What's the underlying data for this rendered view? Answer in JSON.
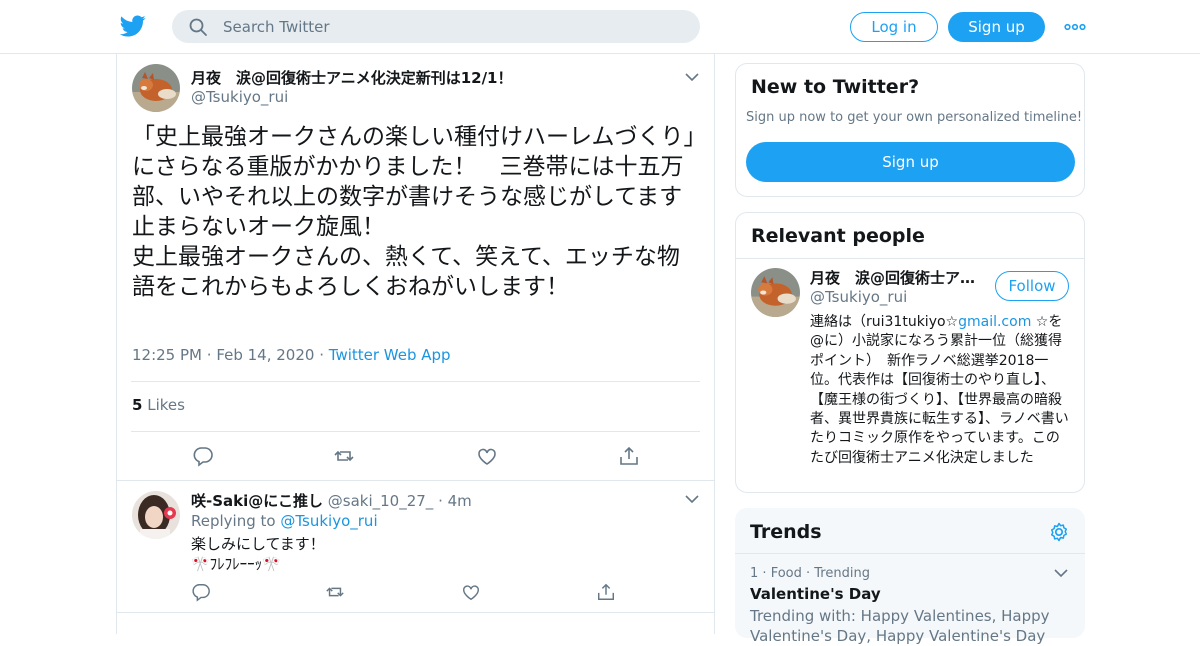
{
  "header": {
    "search_placeholder": "Search Twitter",
    "login_label": "Log in",
    "signup_label": "Sign up",
    "brand_color": "#1da1f2",
    "icons": [
      "twitter-bird-icon",
      "search-icon",
      "more-dots-icon"
    ]
  },
  "tweet": {
    "author_name": "月夜　涙@回復術士アニメ化決定新刊は12/1！",
    "author_handle": "@Tsukiyo_rui",
    "text": "「史上最強オークさんの楽しい種付けハーレムづくり」にさらなる重版がかかりました！　三巻帯には十五万部、いやそれ以上の数字が書けそうな感じがしてます\n止まらないオーク旋風！\n史上最強オークさんの、熱くて、笑えて、エッチな物語をこれからもよろしくおねがいします！",
    "time": "12:25 PM",
    "date": "Feb 14, 2020",
    "source": "Twitter Web App",
    "likes_count": "5",
    "likes_label": "Likes",
    "actions": [
      "reply-icon",
      "retweet-icon",
      "like-icon",
      "share-icon"
    ]
  },
  "reply": {
    "author_name": "咲-Saki@にこ推し",
    "author_handle": "@saki_10_27_",
    "age": "4m",
    "replying_label": "Replying to",
    "replying_to": "@Tsukiyo_rui",
    "text": "楽しみにしてます！\n🎌ﾌﾚﾌﾚｰｰｯ🎌"
  },
  "sidebar": {
    "new_card": {
      "title": "New to Twitter?",
      "subtitle": "Sign up now to get your own personalized timeline!",
      "button": "Sign up"
    },
    "relevant": {
      "title": "Relevant people",
      "name": "月夜　涙@回復術士ア…",
      "handle": "@Tsukiyo_rui",
      "follow_label": "Follow",
      "bio_pre": "連絡は（rui31tukiyo☆",
      "bio_link": "gmail.com",
      "bio_post": " ☆を@に）小説家になろう累計一位（総獲得ポイント）　新作ラノベ総選挙2018一位。代表作は【回復術士のやり直し】、【魔王様の街づくり】、【世界最高の暗殺者、異世界貴族に転生する】、ラノベ書いたりコミック原作をやっています。このたび回復術士アニメ化決定しました"
    },
    "trends": {
      "title": "Trends",
      "rank": "1",
      "category": "Food",
      "trending_label": "Trending",
      "name": "Valentine's Day",
      "with": "Trending with: Happy Valentines, Happy Valentine's Day, Happy Valentine's Day"
    }
  }
}
